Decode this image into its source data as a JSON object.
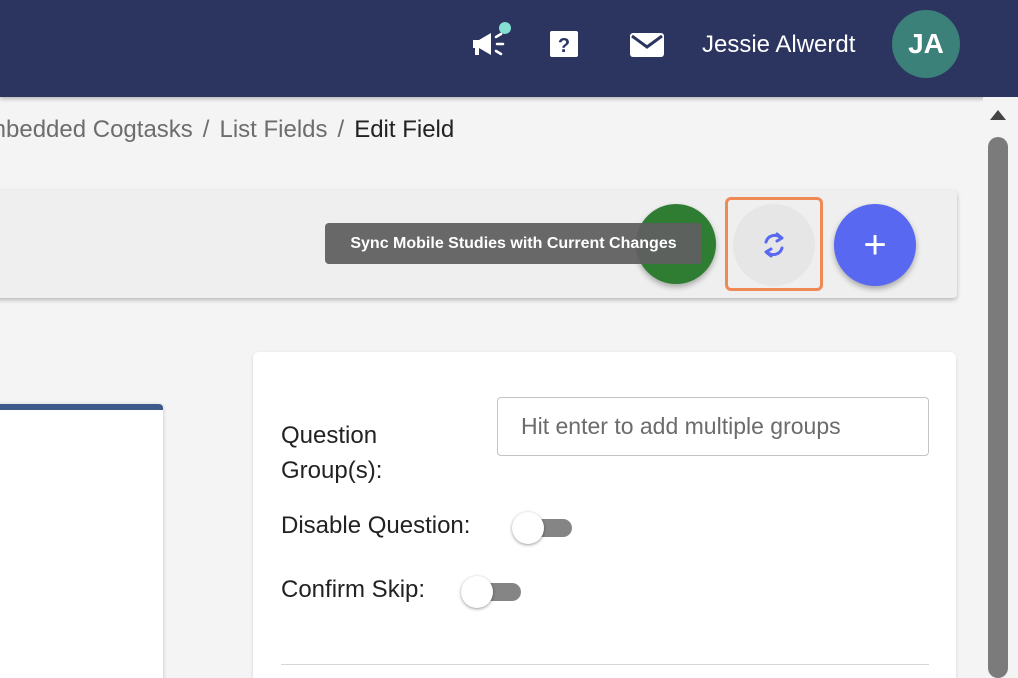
{
  "header": {
    "user_name": "Jessie Alwerdt",
    "avatar_initials": "JA",
    "icons": [
      "megaphone-icon",
      "help-icon",
      "mail-icon"
    ],
    "bar_color": "#2c3560",
    "avatar_color": "#3b8079",
    "notification_dot_color": "#86e0d2"
  },
  "breadcrumb": {
    "items": [
      "mbedded Cogtasks",
      "List Fields",
      "Edit Field"
    ],
    "separator": "/"
  },
  "toolbar": {
    "tooltip": "Sync Mobile Studies with Current Changes",
    "add_label": "+",
    "green_button_color": "#2e7d32",
    "add_button_color": "#5868f0",
    "highlight_color": "#ef8a55"
  },
  "form": {
    "question_groups_label": "Question Group(s):",
    "question_groups_placeholder": "Hit enter to add multiple groups",
    "question_groups_value": "",
    "disable_question_label": "Disable Question:",
    "disable_question_on": false,
    "confirm_skip_label": "Confirm Skip:",
    "confirm_skip_on": false
  }
}
